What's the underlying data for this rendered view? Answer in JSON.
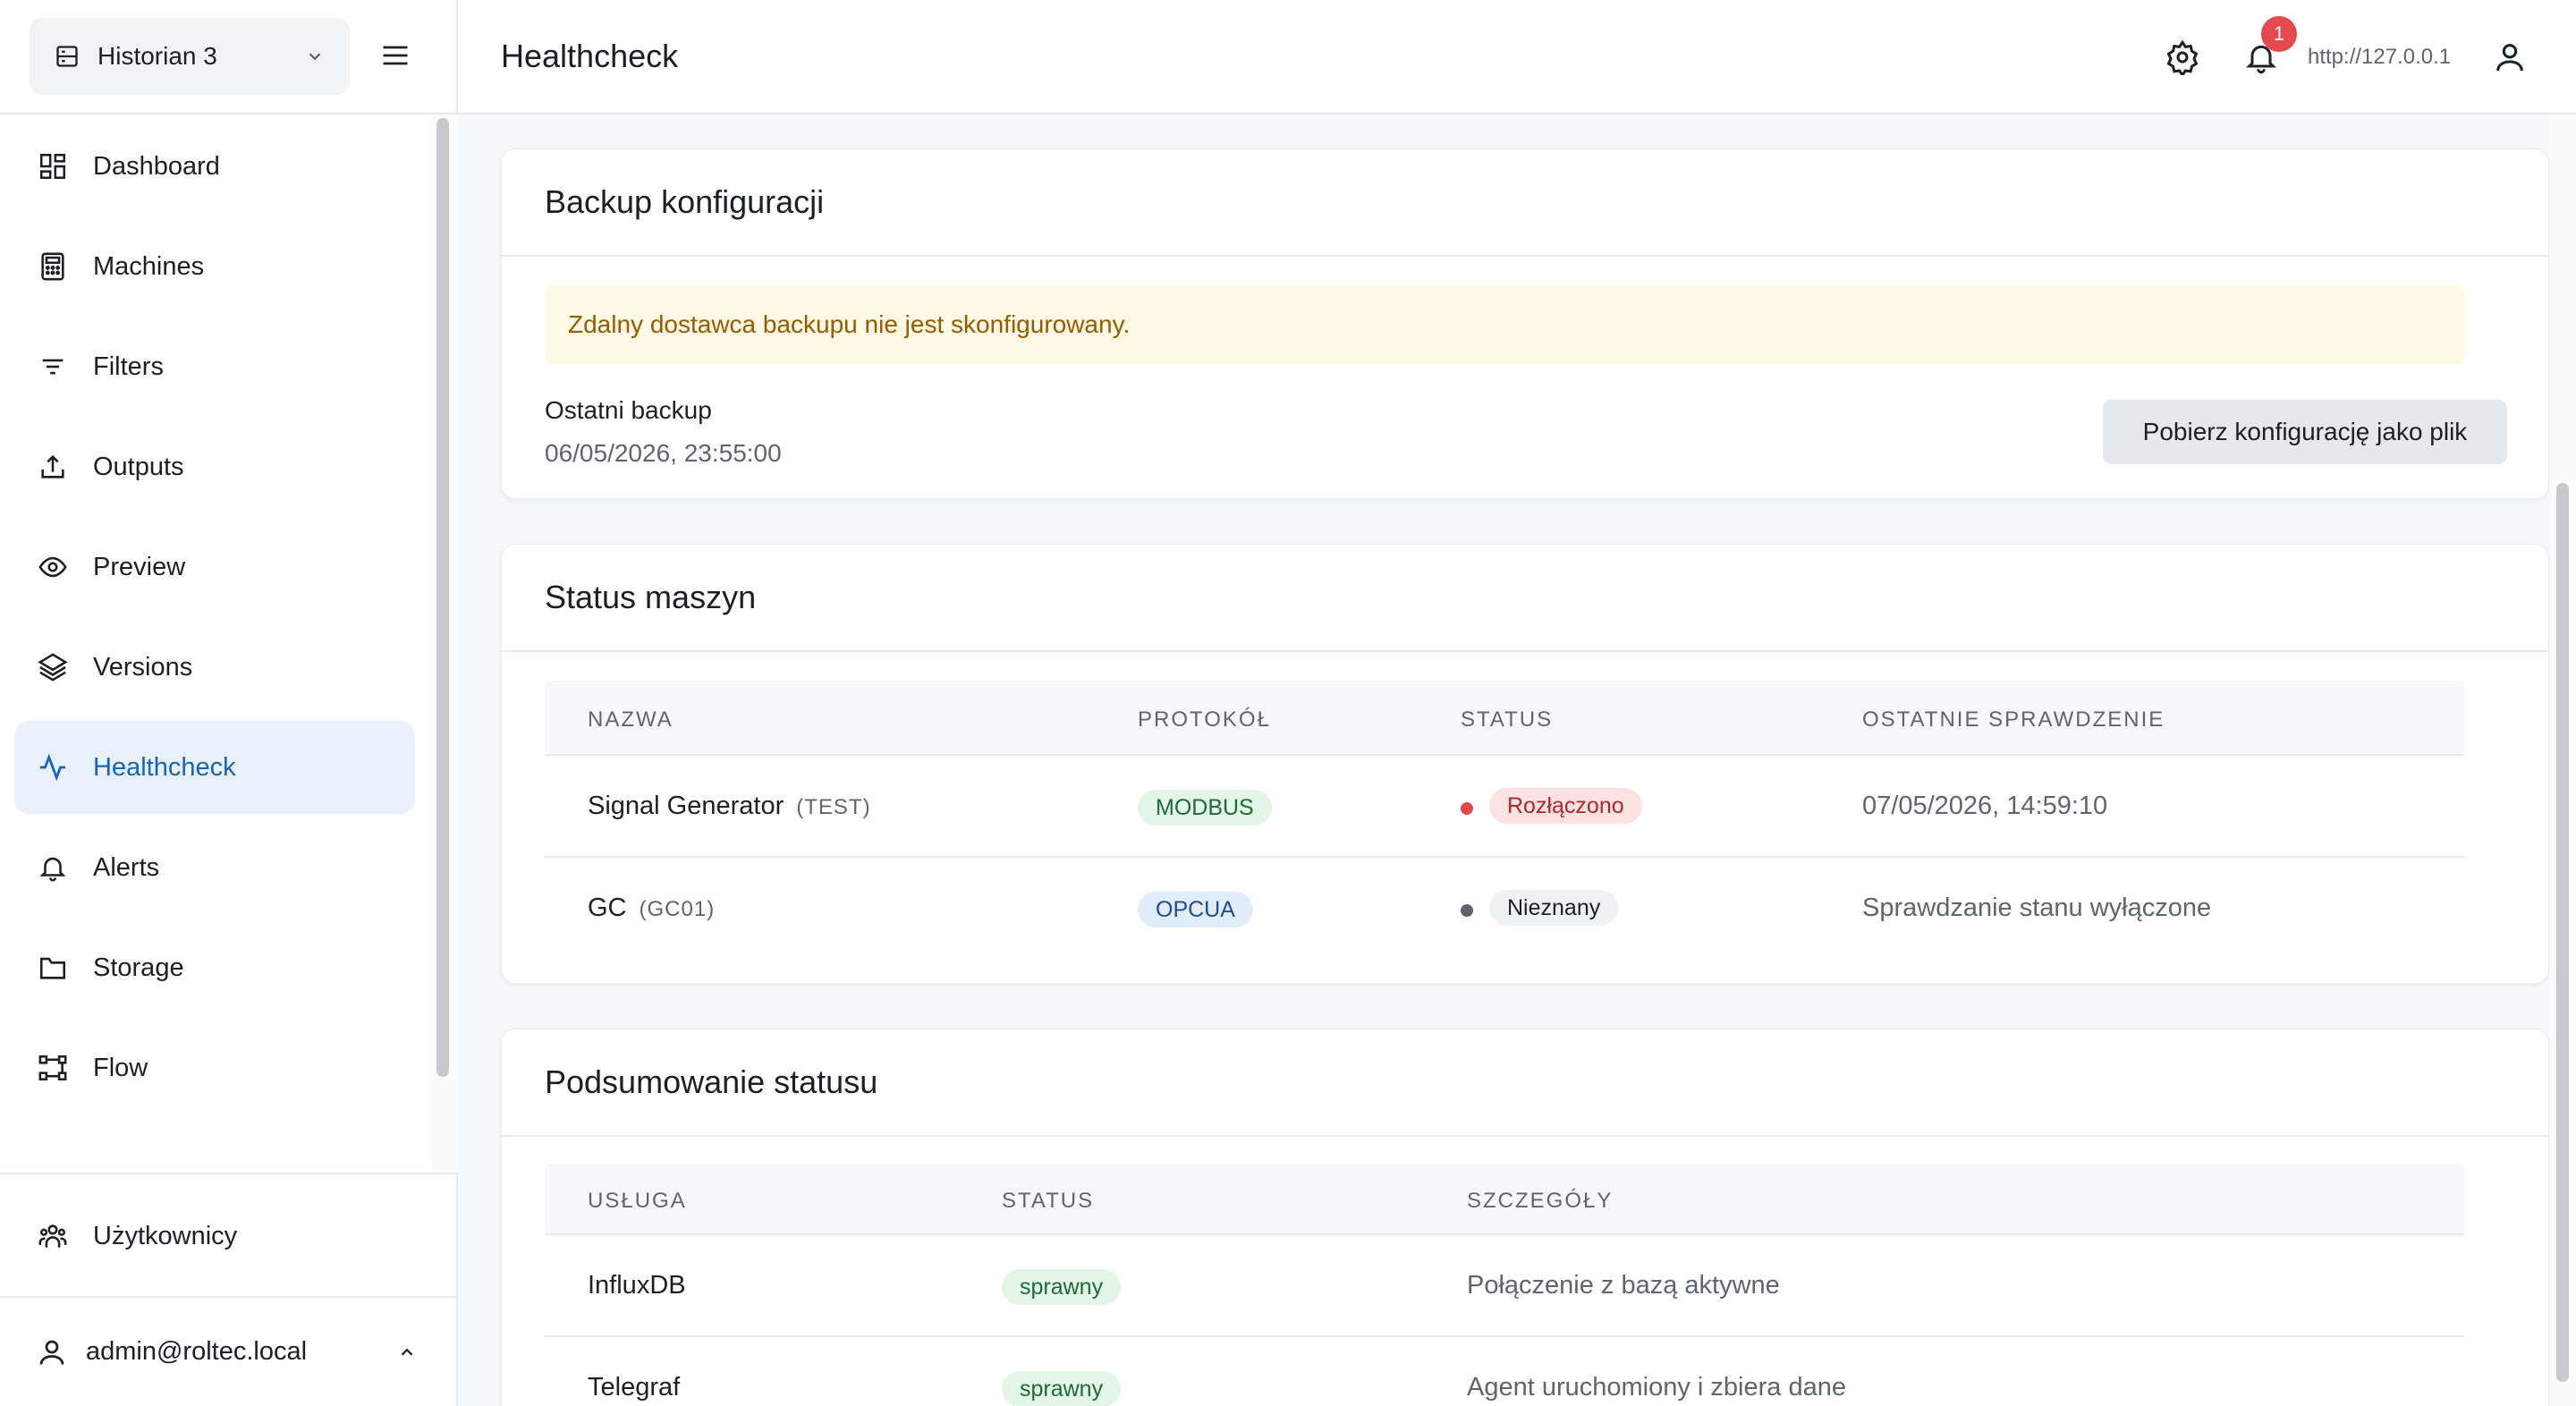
{
  "sidebar": {
    "instance_label": "Historian 3",
    "nav": [
      {
        "label": "Dashboard",
        "icon": "dashboard-icon"
      },
      {
        "label": "Machines",
        "icon": "machines-icon"
      },
      {
        "label": "Filters",
        "icon": "filter-icon"
      },
      {
        "label": "Outputs",
        "icon": "upload-icon"
      },
      {
        "label": "Preview",
        "icon": "eye-icon"
      },
      {
        "label": "Versions",
        "icon": "layers-icon"
      },
      {
        "label": "Healthcheck",
        "icon": "activity-icon",
        "active": true
      },
      {
        "label": "Alerts",
        "icon": "bell-icon"
      },
      {
        "label": "Storage",
        "icon": "folder-icon"
      },
      {
        "label": "Flow",
        "icon": "flow-icon"
      }
    ],
    "users_label": "Użytkownicy",
    "account_email": "admin@roltec.local"
  },
  "topbar": {
    "title": "Healthcheck",
    "notification_count": "1",
    "url": "http://127.0.0.1"
  },
  "backup": {
    "title": "Backup konfiguracji",
    "warning": "Zdalny dostawca backupu nie jest skonfigurowany.",
    "last_label": "Ostatni backup",
    "last_value": "06/05/2026, 23:55:00",
    "download_button": "Pobierz konfigurację jako plik"
  },
  "machines": {
    "title": "Status maszyn",
    "headers": [
      "NAZWA",
      "PROTOKÓŁ",
      "STATUS",
      "OSTATNIE SPRAWDZENIE"
    ],
    "rows": [
      {
        "name": "Signal Generator",
        "code": "(TEST)",
        "protocol": "MODBUS",
        "status": "Rozłączono",
        "last_check": "07/05/2026, 14:59:10"
      },
      {
        "name": "GC",
        "code": "(GC01)",
        "protocol": "OPCUA",
        "status": "Nieznany",
        "last_check": "Sprawdzanie stanu wyłączone"
      }
    ]
  },
  "summary": {
    "title": "Podsumowanie statusu",
    "headers": [
      "USŁUGA",
      "STATUS",
      "SZCZEGÓŁY"
    ],
    "rows": [
      {
        "service": "InfluxDB",
        "status": "sprawny",
        "details": "Połączenie z bazą aktywne"
      },
      {
        "service": "Telegraf",
        "status": "sprawny",
        "details": "Agent uruchomiony i zbiera dane"
      }
    ]
  },
  "colors": {
    "accent": "#1565c0",
    "active_bg": "#e9f1fd",
    "danger": "#e5484d",
    "warning_bg": "#fff9e6",
    "warning_text": "#9a5a00",
    "success_bg": "#e3f6e8"
  }
}
